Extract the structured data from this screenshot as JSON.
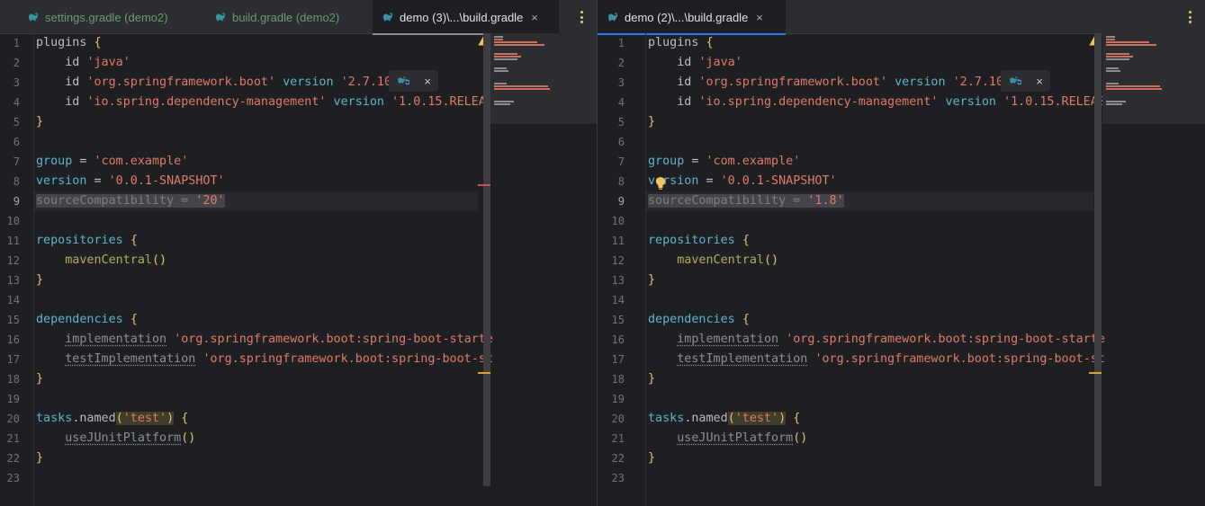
{
  "colors": {
    "editor_bg": "#1e1f22",
    "tabbar_bg": "#2b2d30",
    "gradle_icon": "#3d8fa7",
    "string": "#6aab73",
    "keyword_blue": "#5fb4c9",
    "warning": "#e8c95e",
    "active_tab_underline": "#3574f0"
  },
  "panes": [
    {
      "id": "left",
      "tabs": [
        {
          "label": "settings.gradle (demo2)",
          "active": false
        },
        {
          "label": "build.gradle (demo2)",
          "active": false
        },
        {
          "label": "demo (3)\\...\\build.gradle",
          "active": true,
          "close": "×"
        }
      ],
      "source_compat": "'20'",
      "line_numbers": [
        "1",
        "2",
        "3",
        "4",
        "5",
        "6",
        "7",
        "8",
        "9",
        "10",
        "11",
        "12",
        "13",
        "14",
        "15",
        "16",
        "17",
        "18",
        "19",
        "20",
        "21",
        "22",
        "23"
      ]
    },
    {
      "id": "right",
      "tabs": [
        {
          "label": "demo (2)\\...\\build.gradle",
          "active": true,
          "close": "×"
        }
      ],
      "source_compat": "'1.8'",
      "line_numbers": [
        "1",
        "2",
        "3",
        "4",
        "5",
        "6",
        "7",
        "8",
        "9",
        "10",
        "11",
        "12",
        "13",
        "14",
        "15",
        "16",
        "17",
        "18",
        "19",
        "20",
        "21",
        "22",
        "23"
      ]
    }
  ],
  "code": {
    "plugins": "plugins",
    "brace_open": "{",
    "brace_close": "}",
    "id": "id",
    "java": "'java'",
    "spring_boot_plugin": "'org.springframework.boot'",
    "version_kw": "version",
    "spring_boot_version": "'2.7.10",
    "dep_mgmt_plugin": "'io.spring.dependency-management'",
    "dep_mgmt_version": "'1.0.15.RELEAS",
    "group": "group",
    "eq": "=",
    "group_value": "'com.example'",
    "version": "version",
    "version_value": "'0.0.1-SNAPSHOT'",
    "source_compat_kw": "sourceCompatibility",
    "repositories": "repositories",
    "maven_central": "mavenCentral",
    "parens": "()",
    "dependencies": "dependencies",
    "implementation": "implementation",
    "impl_value": "'org.springframework.boot:spring-boot-starte",
    "test_implementation": "testImplementation",
    "test_impl_value": "'org.springframework.boot:spring-boot-st",
    "tasks": "tasks",
    "dot": ".",
    "named": "named",
    "paren_open": "(",
    "test_str": "'test'",
    "paren_close": ")",
    "use_junit": "useJUnitPlatform"
  },
  "inlay_close": "×",
  "icons": {
    "tab_icon": "gradle-elephant-icon",
    "warning": "warning-icon",
    "intention": "lightbulb-icon",
    "more": "more-vertical-icon"
  }
}
